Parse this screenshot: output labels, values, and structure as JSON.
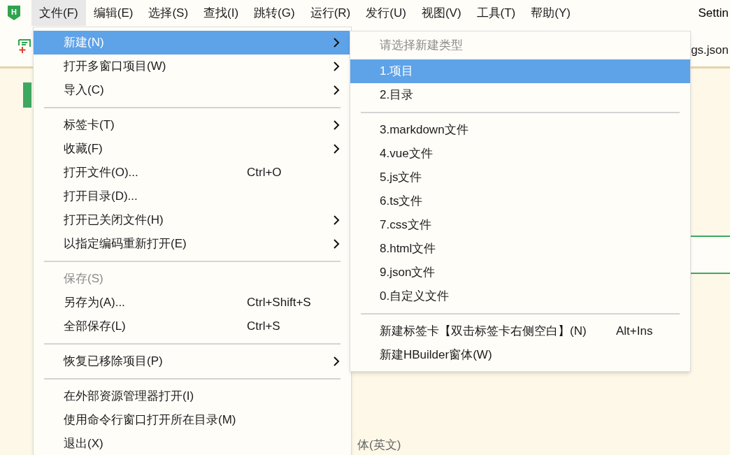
{
  "menubar": [
    {
      "label": "文件(F)",
      "selected": true
    },
    {
      "label": "编辑(E)",
      "selected": false
    },
    {
      "label": "选择(S)",
      "selected": false
    },
    {
      "label": "查找(I)",
      "selected": false
    },
    {
      "label": "跳转(G)",
      "selected": false
    },
    {
      "label": "运行(R)",
      "selected": false
    },
    {
      "label": "发行(U)",
      "selected": false
    },
    {
      "label": "视图(V)",
      "selected": false
    },
    {
      "label": "工具(T)",
      "selected": false
    },
    {
      "label": "帮助(Y)",
      "selected": false
    }
  ],
  "logo": "H",
  "window_title": "Settin",
  "editor_tab": "gs.json",
  "background_label": "体(英文)",
  "file_menu": [
    {
      "kind": "item",
      "label": "新建(N)",
      "submenu": true,
      "selected": true,
      "disabled": false
    },
    {
      "kind": "item",
      "label": "打开多窗口项目(W)",
      "submenu": true,
      "selected": false,
      "disabled": false
    },
    {
      "kind": "item",
      "label": "导入(C)",
      "submenu": true,
      "selected": false,
      "disabled": false
    },
    {
      "kind": "separator"
    },
    {
      "kind": "item",
      "label": "标签卡(T)",
      "submenu": true,
      "selected": false,
      "disabled": false
    },
    {
      "kind": "item",
      "label": "收藏(F)",
      "submenu": true,
      "selected": false,
      "disabled": false
    },
    {
      "kind": "item",
      "label": "打开文件(O)...",
      "shortcut": "Ctrl+O",
      "submenu": false,
      "selected": false,
      "disabled": false
    },
    {
      "kind": "item",
      "label": "打开目录(D)...",
      "submenu": false,
      "selected": false,
      "disabled": false
    },
    {
      "kind": "item",
      "label": "打开已关闭文件(H)",
      "submenu": true,
      "selected": false,
      "disabled": false
    },
    {
      "kind": "item",
      "label": "以指定编码重新打开(E)",
      "submenu": true,
      "selected": false,
      "disabled": false
    },
    {
      "kind": "separator"
    },
    {
      "kind": "item",
      "label": "保存(S)",
      "submenu": false,
      "selected": false,
      "disabled": true
    },
    {
      "kind": "item",
      "label": "另存为(A)...",
      "shortcut": "Ctrl+Shift+S",
      "submenu": false,
      "selected": false,
      "disabled": false
    },
    {
      "kind": "item",
      "label": "全部保存(L)",
      "shortcut": "Ctrl+S",
      "submenu": false,
      "selected": false,
      "disabled": false
    },
    {
      "kind": "separator"
    },
    {
      "kind": "item",
      "label": "恢复已移除项目(P)",
      "submenu": true,
      "selected": false,
      "disabled": false
    },
    {
      "kind": "separator"
    },
    {
      "kind": "item",
      "label": "在外部资源管理器打开(I)",
      "submenu": false,
      "selected": false,
      "disabled": false
    },
    {
      "kind": "item",
      "label": "使用命令行窗口打开所在目录(M)",
      "submenu": false,
      "selected": false,
      "disabled": false
    },
    {
      "kind": "item",
      "label": "退出(X)",
      "submenu": false,
      "selected": false,
      "disabled": false
    }
  ],
  "new_submenu": [
    {
      "kind": "header",
      "label": "请选择新建类型"
    },
    {
      "kind": "item",
      "label": "1.项目",
      "selected": true
    },
    {
      "kind": "item",
      "label": "2.目录",
      "selected": false
    },
    {
      "kind": "separator"
    },
    {
      "kind": "item",
      "label": "3.markdown文件",
      "selected": false
    },
    {
      "kind": "item",
      "label": "4.vue文件",
      "selected": false
    },
    {
      "kind": "item",
      "label": "5.js文件",
      "selected": false
    },
    {
      "kind": "item",
      "label": "6.ts文件",
      "selected": false
    },
    {
      "kind": "item",
      "label": "7.css文件",
      "selected": false
    },
    {
      "kind": "item",
      "label": "8.html文件",
      "selected": false
    },
    {
      "kind": "item",
      "label": "9.json文件",
      "selected": false
    },
    {
      "kind": "item",
      "label": "0.自定义文件",
      "selected": false
    },
    {
      "kind": "separator"
    },
    {
      "kind": "item",
      "label": "新建标签卡【双击标签卡右侧空白】(N)",
      "shortcut": "Alt+Ins",
      "selected": false
    },
    {
      "kind": "item",
      "label": "新建HBuilder窗体(W)",
      "selected": false
    }
  ]
}
